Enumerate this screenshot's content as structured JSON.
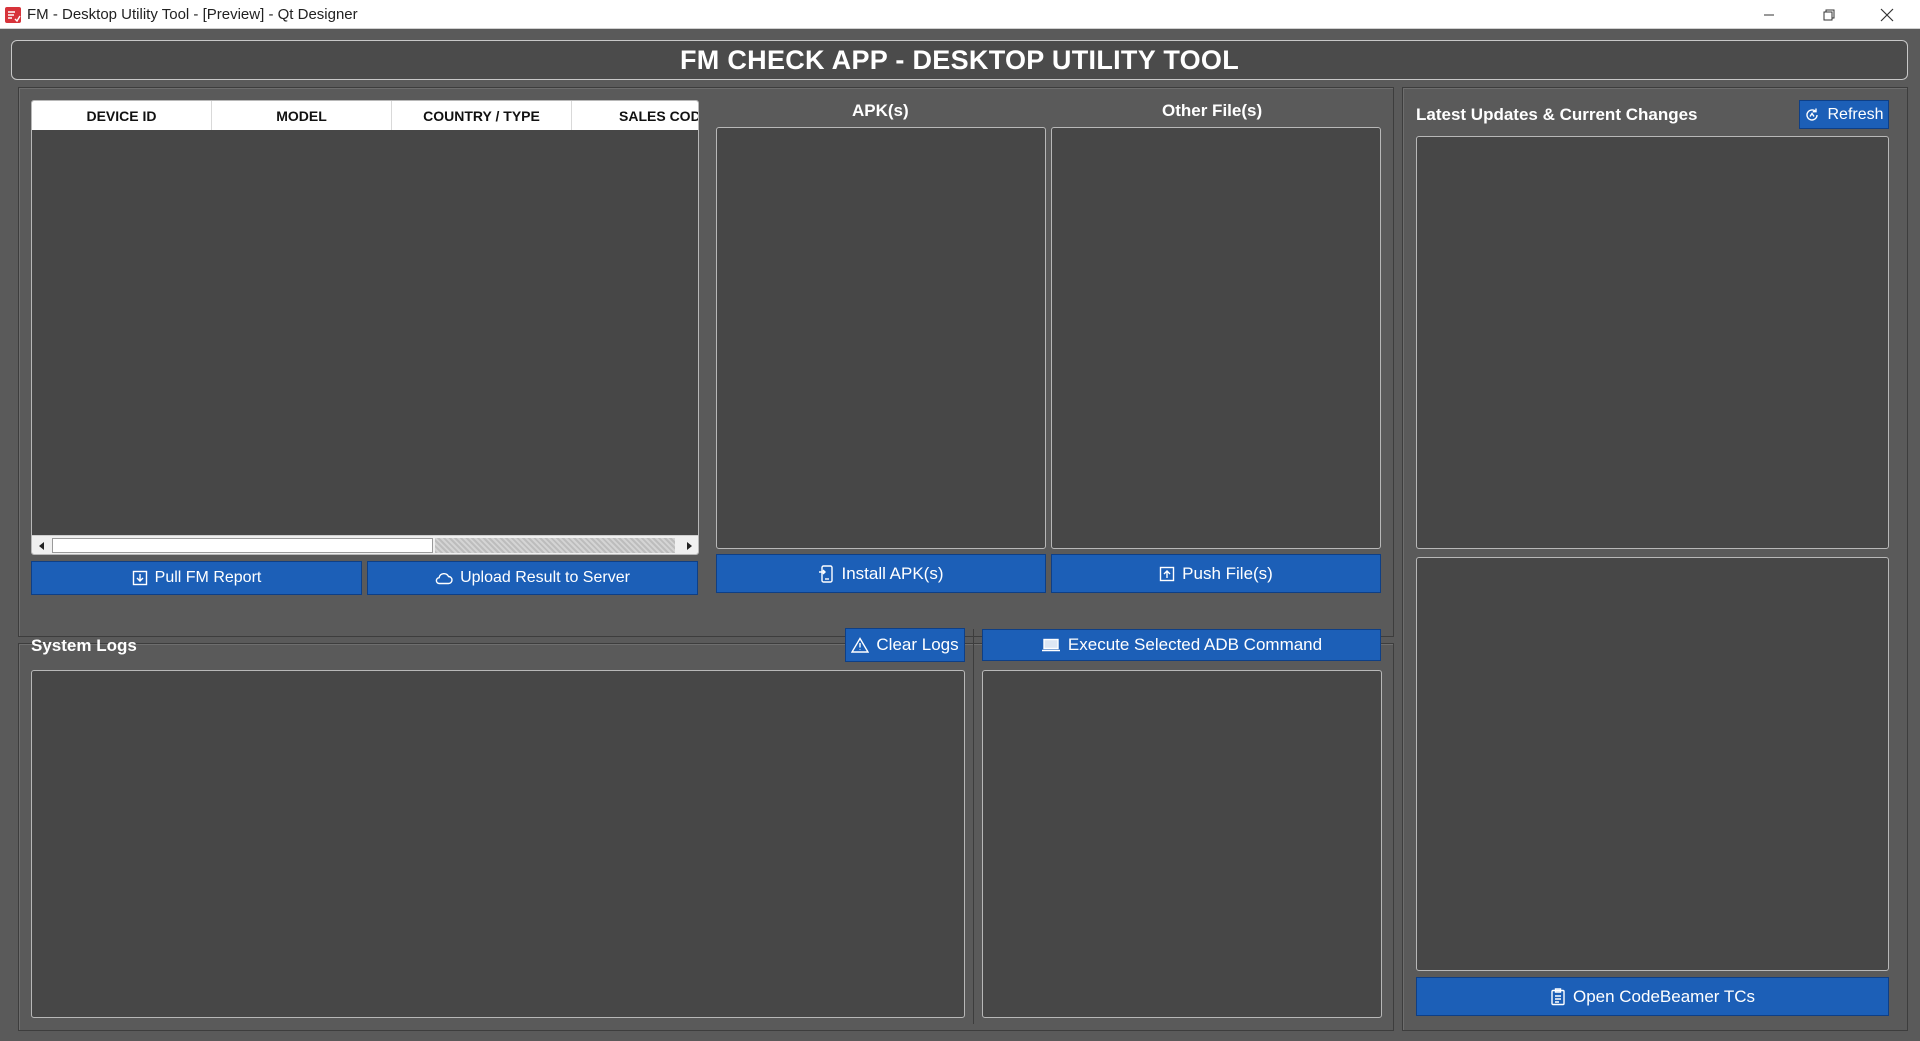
{
  "window": {
    "title": "FM - Desktop Utility Tool - [Preview] - Qt Designer"
  },
  "banner": {
    "title": "FM CHECK APP - DESKTOP UTILITY TOOL"
  },
  "device_table": {
    "columns": [
      "DEVICE ID",
      "MODEL",
      "COUNTRY / TYPE",
      "SALES COD"
    ],
    "rows": []
  },
  "device_actions": {
    "pull_report": "Pull FM Report",
    "upload_result": "Upload Result to Server"
  },
  "files": {
    "apk_label": "APK(s)",
    "other_label": "Other File(s)",
    "install_apk": "Install APK(s)",
    "push_files": "Push File(s)"
  },
  "updates": {
    "label": "Latest Updates & Current Changes",
    "refresh": "Refresh",
    "open_codebeamer": "Open CodeBeamer TCs"
  },
  "logs": {
    "label": "System Logs",
    "clear": "Clear Logs",
    "execute_adb": "Execute Selected ADB Command"
  },
  "colors": {
    "background": "#5a5a5a",
    "panel_dark": "#474747",
    "button_blue": "#1c5fb7",
    "text": "#ffffff"
  },
  "icons": [
    "app-icon",
    "minimize-icon",
    "restore-icon",
    "close-icon",
    "download-icon",
    "cloud-icon",
    "phone-install-icon",
    "upload-icon",
    "refresh-icon",
    "warning-icon",
    "laptop-icon",
    "clipboard-icon"
  ]
}
